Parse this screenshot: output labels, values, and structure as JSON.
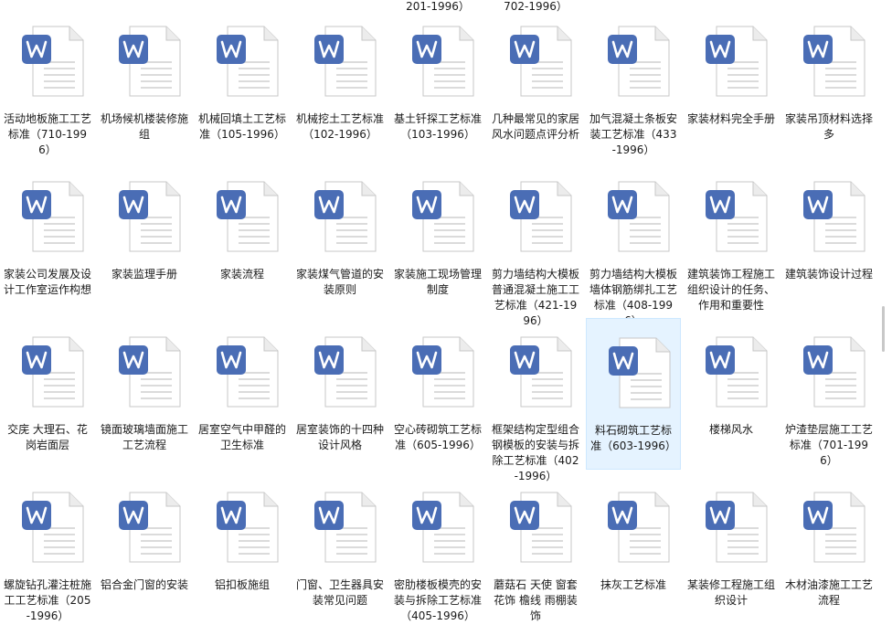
{
  "top_fragments": [
    "201-1996）",
    "702-1996）"
  ],
  "colors": {
    "word_badge": "#4a6db5",
    "page": "#ffffff",
    "lines": "#c9c9c9",
    "selected_bg": "#e5f3ff"
  },
  "icon": "word-document-icon",
  "files": [
    [
      "活动地板施工工艺标准（710-1996）",
      "机场候机楼装修施组",
      "机械回填土工艺标准（105-1996）",
      "机械挖土工艺标准（102-1996）",
      "基土钎探工艺标准（103-1996）",
      "几种最常见的家居风水问题点评分析",
      "加气混凝土条板安装工艺标准（433-1996）",
      "家装材料完全手册",
      "家装吊顶材料选择多"
    ],
    [
      "家装公司发展及设计工作室运作构想",
      "家装监理手册",
      "家装流程",
      "家装煤气管道的安装原则",
      "家装施工现场管理制度",
      "剪力墙结构大模板普通混凝土施工工艺标准（421-1996）",
      "剪力墙结构大模板墙体钢筋绑扎工艺标准（408-1996）",
      "建筑装饰工程施工组织设计的任务、作用和重要性",
      "建筑装饰设计过程"
    ],
    [
      "交庑 大理石、花岗岩面层",
      "镜面玻璃墙面施工工艺流程",
      "居室空气中甲醛的卫生标准",
      "居室装饰的十四种设计风格",
      "空心砖砌筑工艺标准（605-1996）",
      "框架结构定型组合钢模板的安装与拆除工艺标准（402-1996）",
      "料石砌筑工艺标准（603-1996）",
      "楼梯风水",
      "炉渣垫层施工工艺标准（701-1996）"
    ],
    [
      "螺旋钻孔灌注桩施工工艺标准（205-1996）",
      "铝合金门窗的安装",
      "铝扣板施组",
      "门窗、卫生器具安装常见问题",
      "密肋楼板模壳的安装与拆除工艺标准（405-1996）",
      "蘑菇石 天使 窗套 花饰 檐线 雨棚装饰",
      "抹灰工艺标准",
      "某装修工程施工组织设计",
      "木材油漆施工工艺流程"
    ]
  ],
  "selected": {
    "row": 2,
    "col": 6
  }
}
